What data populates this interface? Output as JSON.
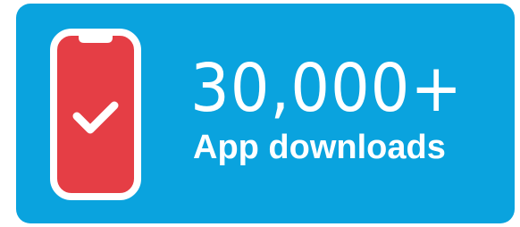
{
  "stat": {
    "value": "30,000+",
    "label": "App downloads"
  },
  "icon": "phone-checkmark-icon",
  "colors": {
    "background": "#0aa3de",
    "phone_screen": "#e53e45",
    "foreground": "#ffffff"
  }
}
